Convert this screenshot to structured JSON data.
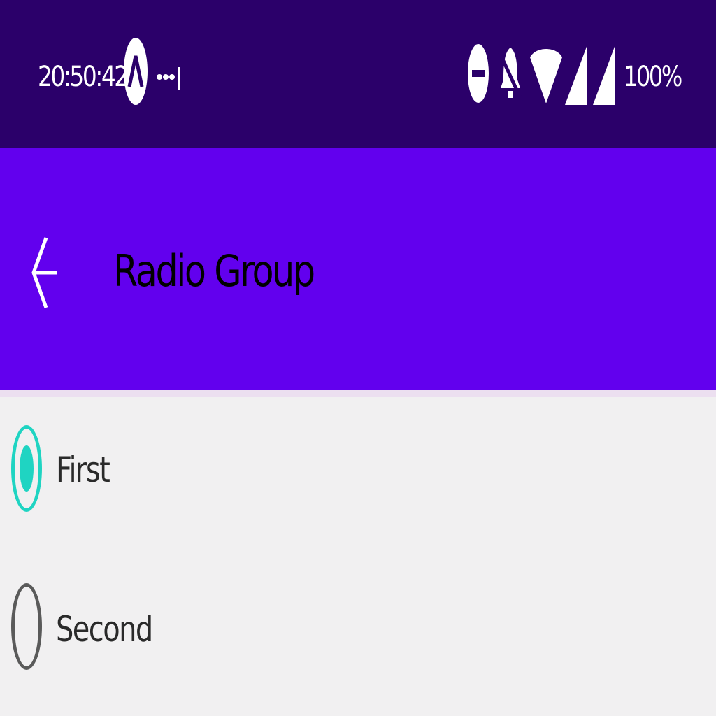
{
  "status_bar": {
    "time": "20:50:42",
    "battery": "100%",
    "icons": [
      "app-a-icon",
      "more-dots-icon",
      "do-not-disturb-icon",
      "notifications-off-icon",
      "wifi-icon",
      "signal-icon",
      "signal-icon"
    ]
  },
  "app_bar": {
    "title": "Radio Group",
    "back_icon": "arrow-back-icon"
  },
  "radio_group": {
    "options": [
      {
        "label": "First",
        "selected": true
      },
      {
        "label": "Second",
        "selected": false
      }
    ]
  },
  "colors": {
    "status_bar": "#2b006a",
    "app_bar": "#6200ee",
    "background": "#f1f0f1",
    "radio_selected": "#1fd4c2",
    "radio_unselected": "#5a5a5a"
  }
}
